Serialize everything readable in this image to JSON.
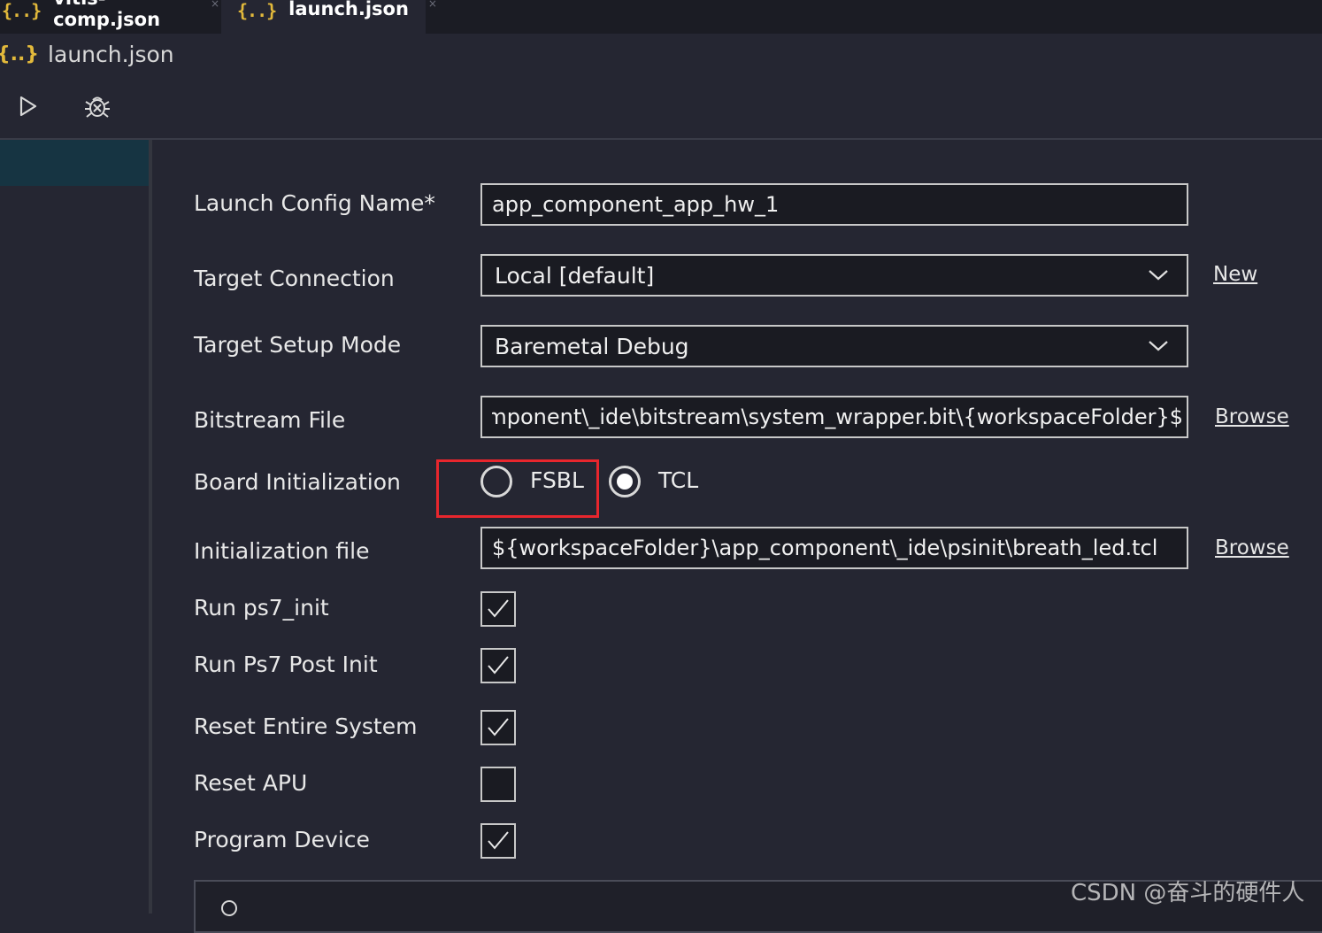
{
  "tabs": [
    {
      "icon": "{..}",
      "label": "vitis-comp.json",
      "close": "×"
    },
    {
      "icon": "{..}",
      "label": "launch.json",
      "close": "×"
    }
  ],
  "breadcrumb": {
    "icon": "{..}",
    "label": "launch.json"
  },
  "form": {
    "launch_config_name": {
      "label": "Launch Config Name*",
      "value": "app_component_app_hw_1"
    },
    "target_connection": {
      "label": "Target Connection",
      "value": "Local [default]",
      "link": "New"
    },
    "target_setup_mode": {
      "label": "Target Setup Mode",
      "value": "Baremetal Debug"
    },
    "bitstream_file": {
      "label": "Bitstream File",
      "value": "${workspaceFolder}\\app_component\\_ide\\bitstream\\system_wrapper.bit",
      "link": "Browse"
    },
    "board_initialization": {
      "label": "Board Initialization",
      "options": [
        "FSBL",
        "TCL"
      ],
      "selected": "TCL"
    },
    "initialization_file": {
      "label": "Initialization file",
      "value": "${workspaceFolder}\\app_component\\_ide\\psinit\\breath_led.tcl",
      "link": "Browse"
    },
    "checkboxes": [
      {
        "label": "Run ps7_init",
        "checked": true
      },
      {
        "label": "Run Ps7 Post Init",
        "checked": true
      },
      {
        "label": "Reset Entire System",
        "checked": true
      },
      {
        "label": "Reset APU",
        "checked": false
      },
      {
        "label": "Program Device",
        "checked": true
      }
    ]
  },
  "watermark": "CSDN @奋斗的硬件人",
  "colors": {
    "highlight_border": "#e8262d",
    "json_icon": "#e2b93b",
    "sidebar_selected": "#163442"
  }
}
